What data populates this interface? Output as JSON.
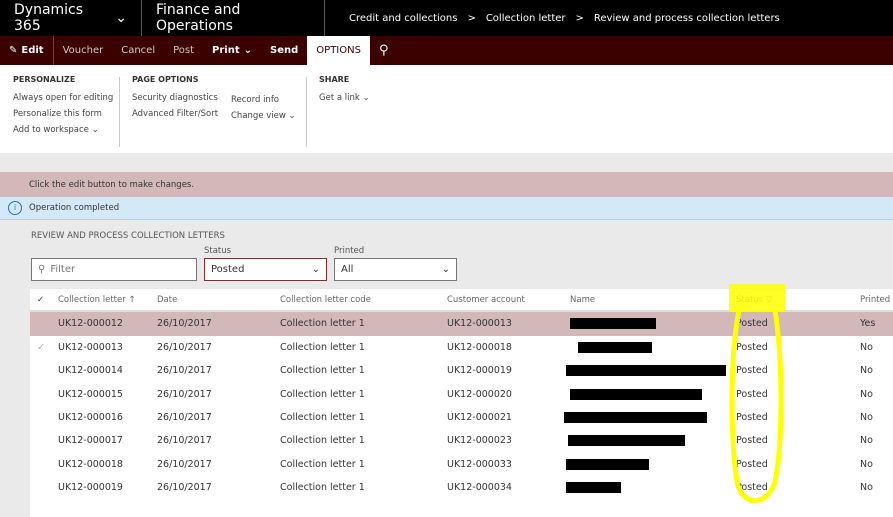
{
  "topbar": {
    "brand": "Dynamics 365",
    "app": "Finance and Operations",
    "breadcrumb": [
      "Credit and collections",
      "Collection letter",
      "Review and process collection letters"
    ]
  },
  "actions": {
    "edit": "Edit",
    "voucher": "Voucher",
    "cancel": "Cancel",
    "post": "Post",
    "print": "Print",
    "send": "Send",
    "options": "OPTIONS"
  },
  "options_pane": {
    "personalize": {
      "title": "PERSONALIZE",
      "items": [
        "Always open for editing",
        "Personalize this form",
        "Add to workspace"
      ]
    },
    "page_options": {
      "title": "PAGE OPTIONS",
      "items": [
        "Security diagnostics",
        "Advanced Filter/Sort",
        "Record info",
        "Change view"
      ]
    },
    "share": {
      "title": "SHARE",
      "items": [
        "Get a link"
      ]
    }
  },
  "message": "Click the edit button to make changes.",
  "info": "Operation completed",
  "section_title": "REVIEW AND PROCESS COLLECTION LETTERS",
  "filters": {
    "filter_placeholder": "Filter",
    "status_label": "Status",
    "status_value": "Posted",
    "printed_label": "Printed",
    "printed_value": "All"
  },
  "grid": {
    "columns": [
      "Collection letter",
      "Date",
      "Collection letter code",
      "Customer account",
      "Name",
      "Status",
      "Printed"
    ],
    "rows": [
      [
        "UK12-000012",
        "26/10/2017",
        "Collection letter 1",
        "UK12-000013",
        "",
        "Posted",
        "Yes"
      ],
      [
        "UK12-000013",
        "26/10/2017",
        "Collection letter 1",
        "UK12-000018",
        "",
        "Posted",
        "No"
      ],
      [
        "UK12-000014",
        "26/10/2017",
        "Collection letter 1",
        "UK12-000019",
        "",
        "Posted",
        "No"
      ],
      [
        "UK12-000015",
        "26/10/2017",
        "Collection letter 1",
        "UK12-000020",
        "",
        "Posted",
        "No"
      ],
      [
        "UK12-000016",
        "26/10/2017",
        "Collection letter 1",
        "UK12-000021",
        "",
        "Posted",
        "No"
      ],
      [
        "UK12-000017",
        "26/10/2017",
        "Collection letter 1",
        "UK12-000023",
        "",
        "Posted",
        "No"
      ],
      [
        "UK12-000018",
        "26/10/2017",
        "Collection letter 1",
        "UK12-000033",
        "",
        "Posted",
        "No"
      ],
      [
        "UK12-000019",
        "26/10/2017",
        "Collection letter 1",
        "UK12-000034",
        "",
        "Posted",
        "No"
      ]
    ]
  },
  "colors": {
    "accent": "#3b0000",
    "selected_row": "#d2b8b9",
    "highlight": "#ffff00"
  }
}
